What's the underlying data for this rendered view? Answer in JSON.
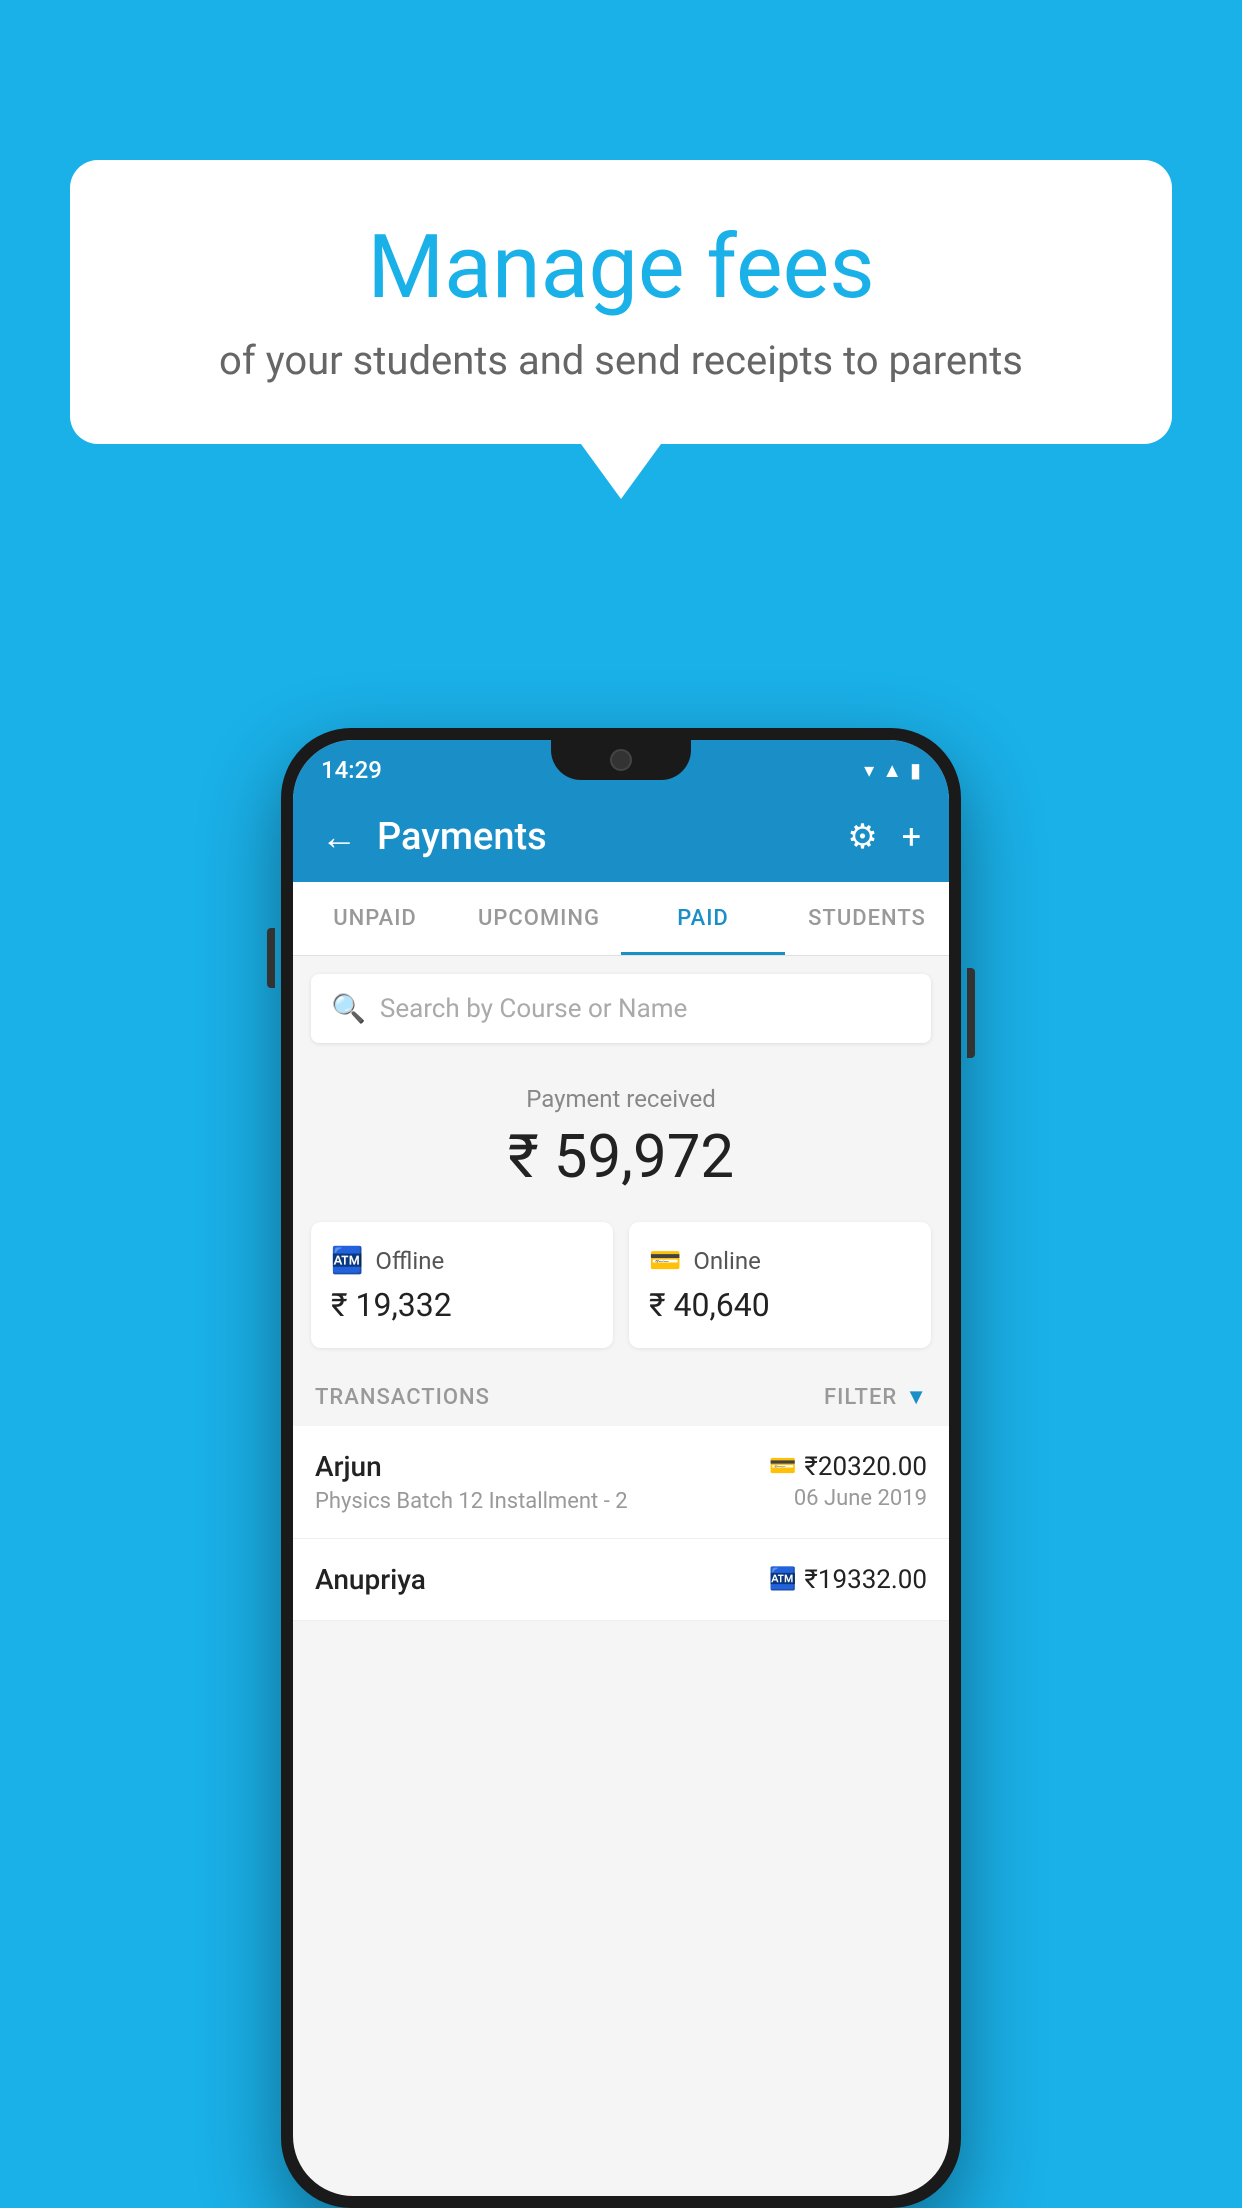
{
  "background": {
    "color": "#1ab0e8"
  },
  "speech_bubble": {
    "title": "Manage fees",
    "subtitle": "of your students and send receipts to parents"
  },
  "status_bar": {
    "time": "14:29",
    "icons": [
      "wifi",
      "signal",
      "battery"
    ]
  },
  "header": {
    "title": "Payments",
    "back_label": "←",
    "gear_label": "⚙",
    "plus_label": "+"
  },
  "tabs": [
    {
      "label": "UNPAID",
      "active": false
    },
    {
      "label": "UPCOMING",
      "active": false
    },
    {
      "label": "PAID",
      "active": true
    },
    {
      "label": "STUDENTS",
      "active": false
    }
  ],
  "search": {
    "placeholder": "Search by Course or Name"
  },
  "payment_summary": {
    "label": "Payment received",
    "amount": "₹ 59,972",
    "offline": {
      "label": "Offline",
      "amount": "₹ 19,332"
    },
    "online": {
      "label": "Online",
      "amount": "₹ 40,640"
    }
  },
  "transactions": {
    "section_label": "TRANSACTIONS",
    "filter_label": "FILTER",
    "items": [
      {
        "name": "Arjun",
        "detail": "Physics Batch 12 Installment - 2",
        "amount": "₹20320.00",
        "date": "06 June 2019",
        "icon": "card"
      },
      {
        "name": "Anupriya",
        "detail": "",
        "amount": "₹19332.00",
        "date": "",
        "icon": "cash"
      }
    ]
  }
}
